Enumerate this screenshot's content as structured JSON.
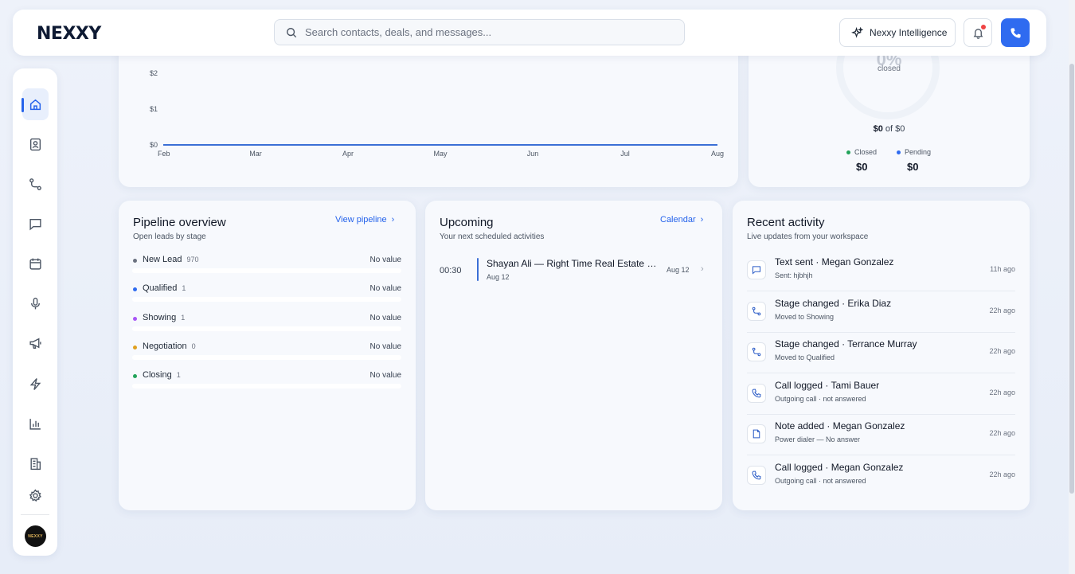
{
  "app": {
    "logo": "NEXXY"
  },
  "search": {
    "placeholder": "Search contacts, deals, and messages..."
  },
  "header": {
    "intelligence_label": "Nexxy Intelligence"
  },
  "sidebar": {
    "items": [
      {
        "name": "home",
        "active": true
      },
      {
        "name": "contacts"
      },
      {
        "name": "pipeline"
      },
      {
        "name": "messages"
      },
      {
        "name": "calendar"
      },
      {
        "name": "voice"
      },
      {
        "name": "campaigns"
      },
      {
        "name": "automations"
      },
      {
        "name": "reports"
      },
      {
        "name": "company"
      },
      {
        "name": "settings"
      }
    ],
    "avatar_text": "NEXXY"
  },
  "chart_data": {
    "type": "line",
    "categories": [
      "Feb",
      "Mar",
      "Apr",
      "May",
      "Jun",
      "Jul",
      "Aug"
    ],
    "series": [
      {
        "values": [
          0,
          0,
          0,
          0,
          0,
          0,
          0
        ],
        "color": "#3b6fd6"
      }
    ],
    "yticks": [
      "$2",
      "$1",
      "$0"
    ],
    "ylim": [
      0,
      2
    ]
  },
  "goal": {
    "percent": "0%",
    "label": "closed",
    "amount": "$0",
    "of_text": "of",
    "total": "$0",
    "closed_label": "Closed",
    "closed_value": "$0",
    "pending_label": "Pending",
    "pending_value": "$0",
    "closed_color": "#22a35a",
    "pending_color": "#2f6bf0"
  },
  "pipeline": {
    "title": "Pipeline overview",
    "subtitle": "Open leads by stage",
    "link": "View pipeline",
    "stages": [
      {
        "name": "New Lead",
        "count": "970",
        "value": "No value",
        "color": "#6b7280"
      },
      {
        "name": "Qualified",
        "count": "1",
        "value": "No value",
        "color": "#2f6bf0"
      },
      {
        "name": "Showing",
        "count": "1",
        "value": "No value",
        "color": "#a855f7"
      },
      {
        "name": "Negotiation",
        "count": "0",
        "value": "No value",
        "color": "#e0a020"
      },
      {
        "name": "Closing",
        "count": "1",
        "value": "No value",
        "color": "#22a35a"
      }
    ]
  },
  "upcoming": {
    "title": "Upcoming",
    "subtitle": "Your next scheduled activities",
    "link": "Calendar",
    "events": [
      {
        "time": "00:30",
        "title": "Shayan Ali — Right Time Real Estate Consultation",
        "date": "Aug 12",
        "date_right": "Aug 12"
      }
    ]
  },
  "activity": {
    "title": "Recent activity",
    "subtitle": "Live updates from your workspace",
    "items": [
      {
        "icon": "message-icon",
        "title": "Text sent · Megan Gonzalez",
        "sub": "Sent: hjbhjh",
        "time": "11h ago"
      },
      {
        "icon": "stage-icon",
        "title": "Stage changed · Erika Diaz",
        "sub": "Moved to Showing",
        "time": "22h ago"
      },
      {
        "icon": "stage-icon",
        "title": "Stage changed · Terrance Murray",
        "sub": "Moved to Qualified",
        "time": "22h ago"
      },
      {
        "icon": "phone-icon",
        "title": "Call logged · Tami Bauer",
        "sub": "Outgoing call · not answered",
        "time": "22h ago"
      },
      {
        "icon": "note-icon",
        "title": "Note added · Megan Gonzalez",
        "sub": "Power dialer — No answer",
        "time": "22h ago"
      },
      {
        "icon": "phone-icon",
        "title": "Call logged · Megan Gonzalez",
        "sub": "Outgoing call · not answered",
        "time": "22h ago"
      }
    ]
  }
}
